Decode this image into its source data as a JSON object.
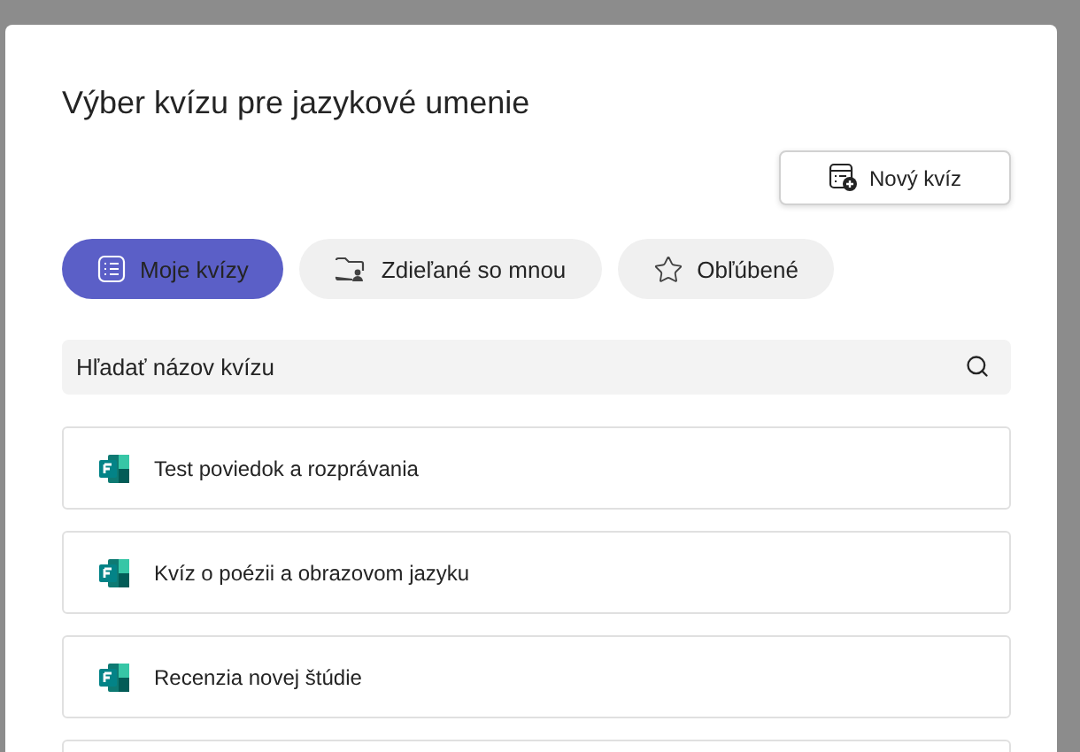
{
  "dialog": {
    "title": "Výber kvízu pre jazykové umenie"
  },
  "new_button": {
    "label": "Nový kvíz"
  },
  "tabs": [
    {
      "kind": "mine",
      "label": "Moje kvízy",
      "selected": true
    },
    {
      "kind": "shared",
      "label": "Zdieľané so mnou",
      "selected": false
    },
    {
      "kind": "favorites",
      "label": "Obľúbené",
      "selected": false
    }
  ],
  "search": {
    "placeholder": "Hľadať názov kvízu"
  },
  "quizzes": [
    {
      "title": "Test poviedok a rozprávania"
    },
    {
      "title": "Kvíz o poézii a obrazovom jazyku"
    },
    {
      "title": "Recenzia novej štúdie"
    }
  ]
}
